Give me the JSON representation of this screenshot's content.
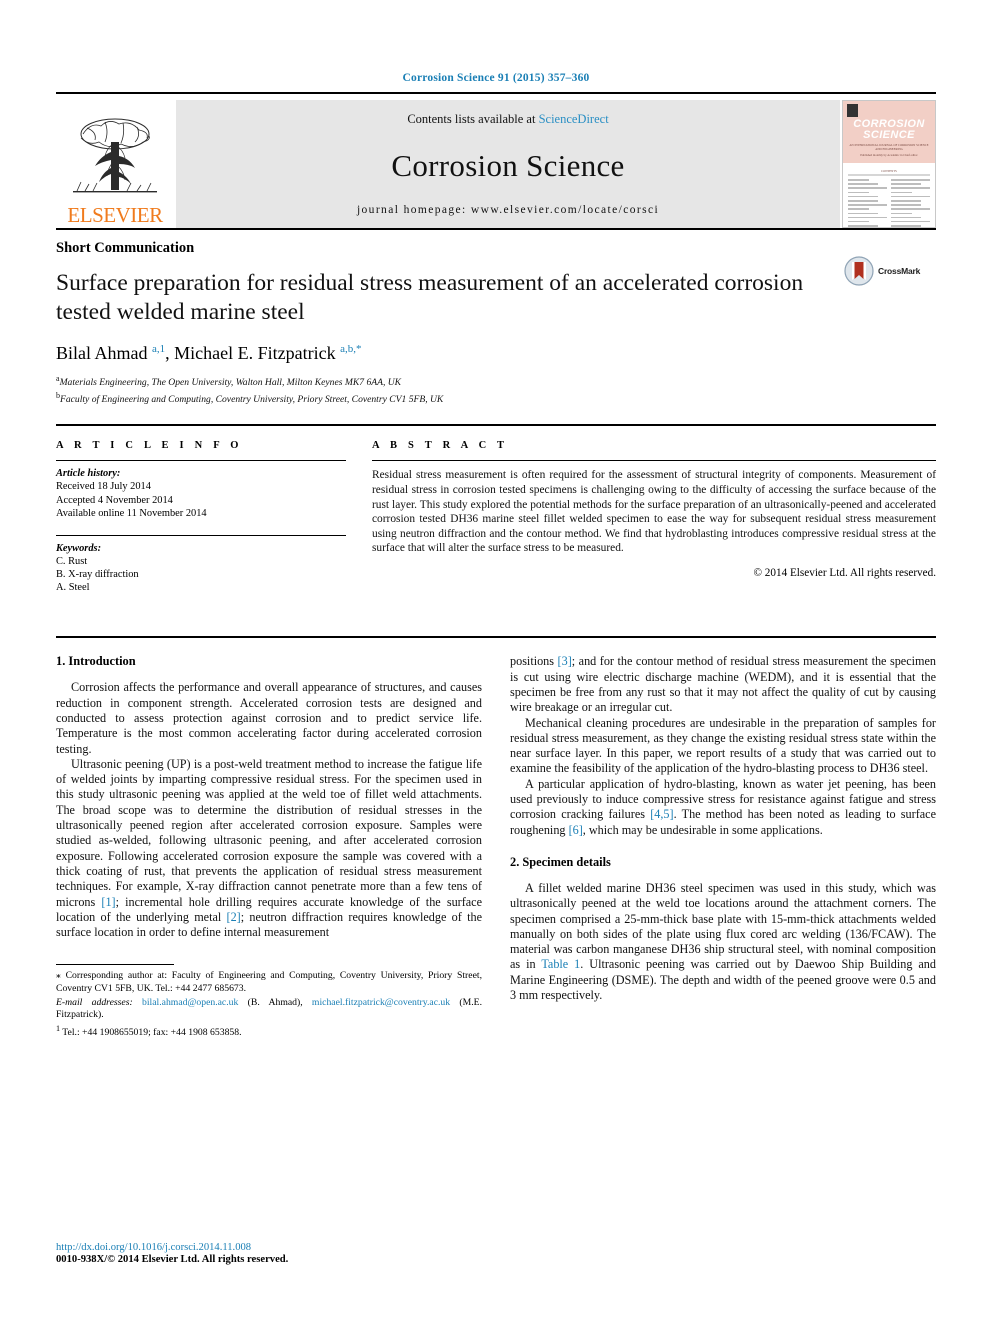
{
  "running_head": "Corrosion Science 91 (2015) 357–360",
  "masthead": {
    "publisher_word": "ELSEVIER",
    "publisher_logo_icon": "elsevier-tree-icon",
    "contents_prefix": "Contents lists available at ",
    "sciencedirect_link": "ScienceDirect",
    "journal_name": "Corrosion Science",
    "homepage_line": "journal homepage: www.elsevier.com/locate/corsci",
    "cover": {
      "title_line1": "CORROSION",
      "title_line2": "SCIENCE",
      "strapline": "AN INTERNATIONAL JOURNAL OF CORROSION SCIENCE AND ENGINEERING",
      "editors_line": "Published monthly by Academic in Chief editor",
      "contents_label": "CONTENTS"
    }
  },
  "article": {
    "type": "Short Communication",
    "title": "Surface preparation for residual stress measurement of an accelerated corrosion tested welded marine steel",
    "crossmark_label": "CrossMark",
    "crossmark_icon": "crossmark-icon",
    "authors_html": "Bilal Ahmad <sup>a,1</sup>, Michael E. Fitzpatrick <sup>a,b,</sup><sup>*</sup>",
    "affiliation_a": "Materials Engineering, The Open University, Walton Hall, Milton Keynes MK7 6AA, UK",
    "affiliation_b": "Faculty of Engineering and Computing, Coventry University, Priory Street, Coventry CV1 5FB, UK",
    "affiliation_a_marker": "a",
    "affiliation_b_marker": "b"
  },
  "article_info": {
    "heading": "A R T I C L E    I N F O",
    "history_label": "Article history:",
    "received": "Received 18 July 2014",
    "accepted": "Accepted 4 November 2014",
    "available": "Available online 11 November 2014",
    "keywords_label": "Keywords:",
    "keywords": [
      "C. Rust",
      "B. X-ray diffraction",
      "A. Steel"
    ]
  },
  "abstract": {
    "heading": "A B S T R A C T",
    "text": "Residual stress measurement is often required for the assessment of structural integrity of components. Measurement of residual stress in corrosion tested specimens is challenging owing to the difficulty of accessing the surface because of the rust layer. This study explored the potential methods for the surface preparation of an ultrasonically-peened and accelerated corrosion tested DH36 marine steel fillet welded specimen to ease the way for subsequent residual stress measurement using neutron diffraction and the contour method. We find that hydroblasting introduces compressive residual stress at the surface that will alter the surface stress to be measured.",
    "copyright": "© 2014 Elsevier Ltd. All rights reserved."
  },
  "body": {
    "left": {
      "heading_1": "1. Introduction",
      "para_1": "Corrosion affects the performance and overall appearance of structures, and causes reduction in component strength. Accelerated corrosion tests are designed and conducted to assess protection against corrosion and to predict service life. Temperature is the most common accelerating factor during accelerated corrosion testing.",
      "para_2_a": "Ultrasonic peening (UP) is a post-weld treatment method to increase the fatigue life of welded joints by imparting compressive residual stress. For the specimen used in this study ultrasonic peening was applied at the weld toe of fillet weld attachments. The broad scope was to determine the distribution of residual stresses in the ultrasonically peened region after accelerated corrosion exposure. Samples were studied as-welded, following ultrasonic peening, and after accelerated corrosion exposure. Following accelerated corrosion exposure the sample was covered with a thick coating of rust, that prevents the application of residual stress measurement techniques. For example, X-ray diffraction cannot penetrate more than a few tens of microns ",
      "ref_1": "[1]",
      "para_2_b": "; incremental hole drilling requires accurate knowledge of the surface location of the underlying metal ",
      "ref_2": "[2]",
      "para_2_c": "; neutron diffraction requires knowledge of the surface location in order to define internal measurement"
    },
    "right": {
      "para_3_a": "positions ",
      "ref_3": "[3]",
      "para_3_b": "; and for the contour method of residual stress measurement the specimen is cut using wire electric discharge machine (WEDM), and it is essential that the specimen be free from any rust so that it may not affect the quality of cut by causing wire breakage or an irregular cut.",
      "para_4": "Mechanical cleaning procedures are undesirable in the preparation of samples for residual stress measurement, as they change the existing residual stress state within the near surface layer. In this paper, we report results of a study that was carried out to examine the feasibility of the application of the hydro-blasting process to DH36 steel.",
      "para_5_a": "A particular application of hydro-blasting, known as water jet peening, has been used previously to induce compressive stress for resistance against fatigue and stress corrosion cracking failures ",
      "ref_45": "[4,5]",
      "para_5_b": ". The method has been noted as leading to surface roughening ",
      "ref_6": "[6]",
      "para_5_c": ", which may be undesirable in some applications.",
      "heading_2": "2. Specimen details",
      "para_6_a": "A fillet welded marine DH36 steel specimen was used in this study, which was ultrasonically peened at the weld toe locations around the attachment corners. The specimen comprised a 25-mm-thick base plate with 15-mm-thick attachments welded manually on both sides of the plate using flux cored arc welding (136/FCAW). The material was carbon manganese DH36 ship structural steel, with nominal composition as in ",
      "table_ref": "Table 1",
      "para_6_b": ". Ultrasonic peening was carried out by Daewoo Ship Building and Marine Engineering (DSME). The depth and width of the peened groove were 0.5 and 3 mm respectively."
    }
  },
  "footnotes": {
    "corresponding_marker": "⁎",
    "corresponding": " Corresponding author at: Faculty of Engineering and Computing, Coventry University, Priory Street, Coventry CV1 5FB, UK. Tel.: +44 2477 685673.",
    "email_label": "E-mail addresses:",
    "email_1": "bilal.ahmad@open.ac.uk",
    "email_1_owner": " (B. Ahmad), ",
    "email_2": "michael.fitzpatrick@coventry.ac.uk",
    "email_2_owner": " (M.E. Fitzpatrick).",
    "note_1_marker": "1",
    "note_1": " Tel.: +44 1908655019; fax: +44 1908 653858."
  },
  "footer": {
    "doi": "http://dx.doi.org/10.1016/j.corsci.2014.11.008",
    "issn_line": "0010-938X/© 2014 Elsevier Ltd. All rights reserved."
  },
  "colors": {
    "link": "#1a7fb5",
    "elsevier_orange": "#F07B1D",
    "masthead_grey": "#e6e6e6",
    "cover_pink": "#f2cfc6"
  }
}
